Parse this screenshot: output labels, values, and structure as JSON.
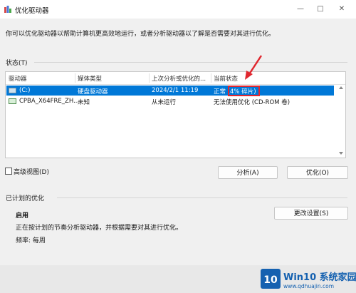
{
  "window": {
    "title": "优化驱动器",
    "minimize_glyph": "—",
    "maximize_glyph": "□",
    "close_glyph": "✕"
  },
  "intro_text": "你可以优化驱动器以帮助计算机更高效地运行，或者分析驱动器以了解是否需要对其进行优化。",
  "status_section": {
    "label": "状态(T)",
    "columns": [
      "驱动器",
      "媒体类型",
      "上次分析或优化的...",
      "当前状态"
    ],
    "rows": [
      {
        "drive": "(C:)",
        "media": "硬盘驱动器",
        "last": "2024/2/1 11:19",
        "status": "正常 (4% 碎片)",
        "icon": "hard-drive-icon"
      },
      {
        "drive": "CPBA_X64FRE_ZH...",
        "media": "未知",
        "last": "从未运行",
        "status": "无法使用优化 (CD-ROM 卷)",
        "icon": "cd-drive-icon"
      }
    ]
  },
  "advanced_view_label": "高级视图(D)",
  "buttons": {
    "analyze": "分析(A)",
    "optimize": "优化(O)",
    "change_settings": "更改设置(S)"
  },
  "scheduled": {
    "label": "已计划的优化",
    "state": "启用",
    "description": "正在按计划的节奏分析驱动器，并根据需要对其进行优化。",
    "frequency": "频率: 每周"
  },
  "watermark": {
    "name": "Win10 系统家园",
    "url": "www.qdhuajin.com"
  },
  "colors": {
    "selection": "#0078d7",
    "annotation": "#e0272f",
    "watermark": "#1561b0"
  }
}
